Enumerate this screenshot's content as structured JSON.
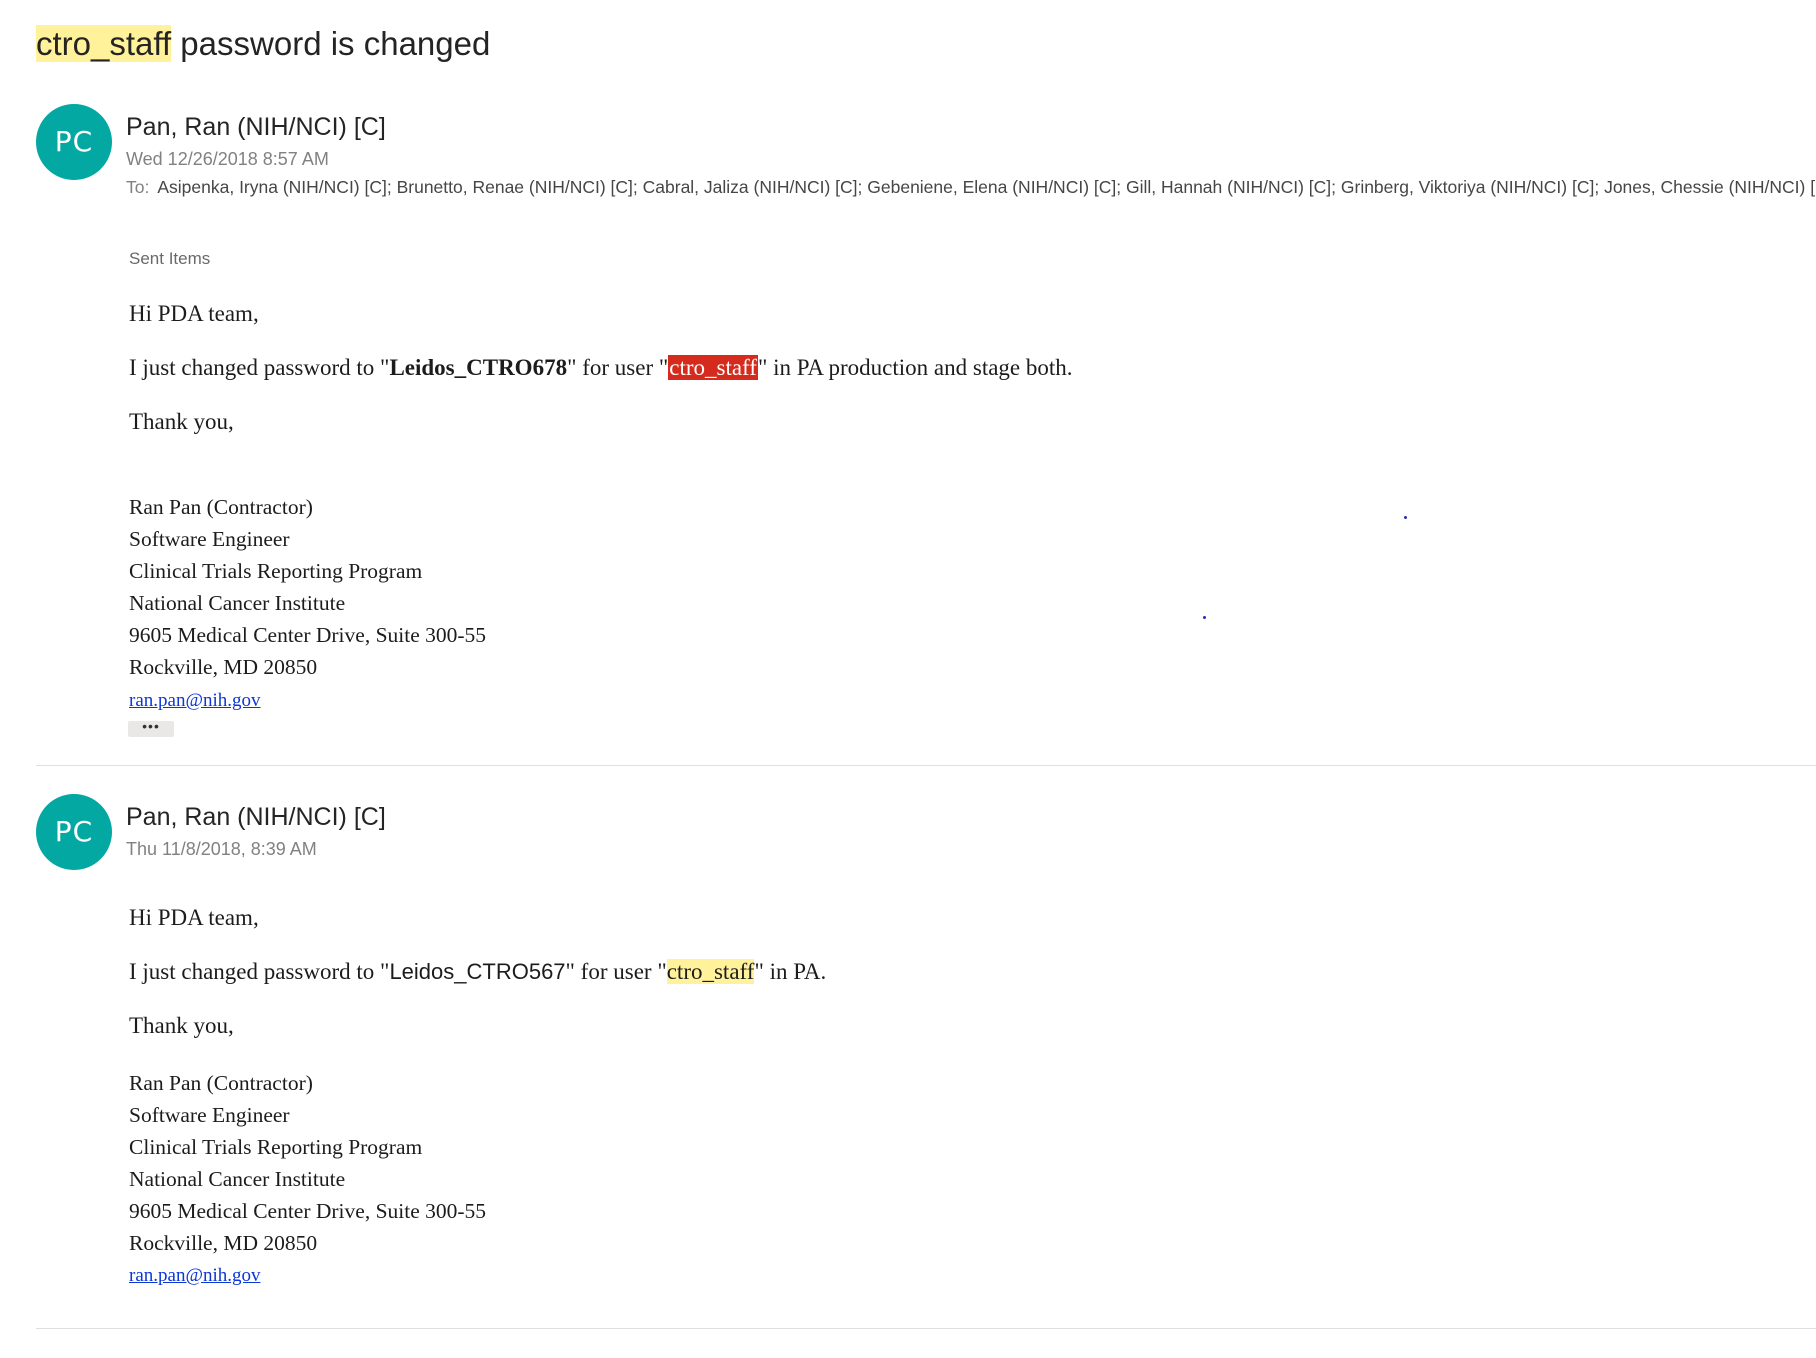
{
  "subject": {
    "highlight": "ctro_staff",
    "rest": " password is changed"
  },
  "messages": [
    {
      "avatar_initials": "PC",
      "sender": "Pan, Ran (NIH/NCI) [C]",
      "date": "Wed 12/26/2018 8:57 AM",
      "to_label": "To:",
      "to_recipients": "Asipenka, Iryna (NIH/NCI) [C]; Brunetto, Renae (NIH/NCI) [C]; Cabral, Jaliza (NIH/NCI) [C]; Gebeniene, Elena (NIH/NCI) [C]; Gill, Hannah (NIH/NCI) [C]; Grinberg, Viktoriya (NIH/NCI) [C]; Jones, Chessie (NIH/NCI) [",
      "folder": "Sent Items",
      "greeting": "Hi PDA team,",
      "body_pre": "I just changed password to \"",
      "password": "Leidos_CTRO678",
      "body_mid": "\" for user \"",
      "user": "ctro_staff",
      "body_post": "\" in PA production and stage both.",
      "closing": "Thank you,",
      "signature": {
        "name": "Ran Pan (Contractor)",
        "title": "Software Engineer",
        "program": "Clinical Trials Reporting Program",
        "institute": "National Cancer Institute",
        "address": "9605 Medical Center Drive, Suite 300-55",
        "city": "Rockville, MD 20850",
        "email": "ran.pan@nih.gov"
      },
      "more_label": "•••"
    },
    {
      "avatar_initials": "PC",
      "sender": "Pan, Ran (NIH/NCI) [C]",
      "date": "Thu 11/8/2018, 8:39 AM",
      "greeting": "Hi PDA team,",
      "body_pre": "I just changed password to \"",
      "password": "Leidos_CTRO567",
      "body_mid": "\" for user \"",
      "user": "ctro_staff",
      "body_post": "\" in PA.",
      "closing": "Thank you,",
      "signature": {
        "name": "Ran Pan (Contractor)",
        "title": "Software Engineer",
        "program": "Clinical Trials Reporting Program",
        "institute": "National Cancer Institute",
        "address": "9605 Medical Center Drive, Suite 300-55",
        "city": "Rockville, MD 20850",
        "email": "ran.pan@nih.gov"
      }
    }
  ],
  "colors": {
    "avatar": "#03a8a3",
    "highlight_yellow": "#fff29b",
    "highlight_red": "#d42b1d",
    "link": "#0b37d6"
  }
}
